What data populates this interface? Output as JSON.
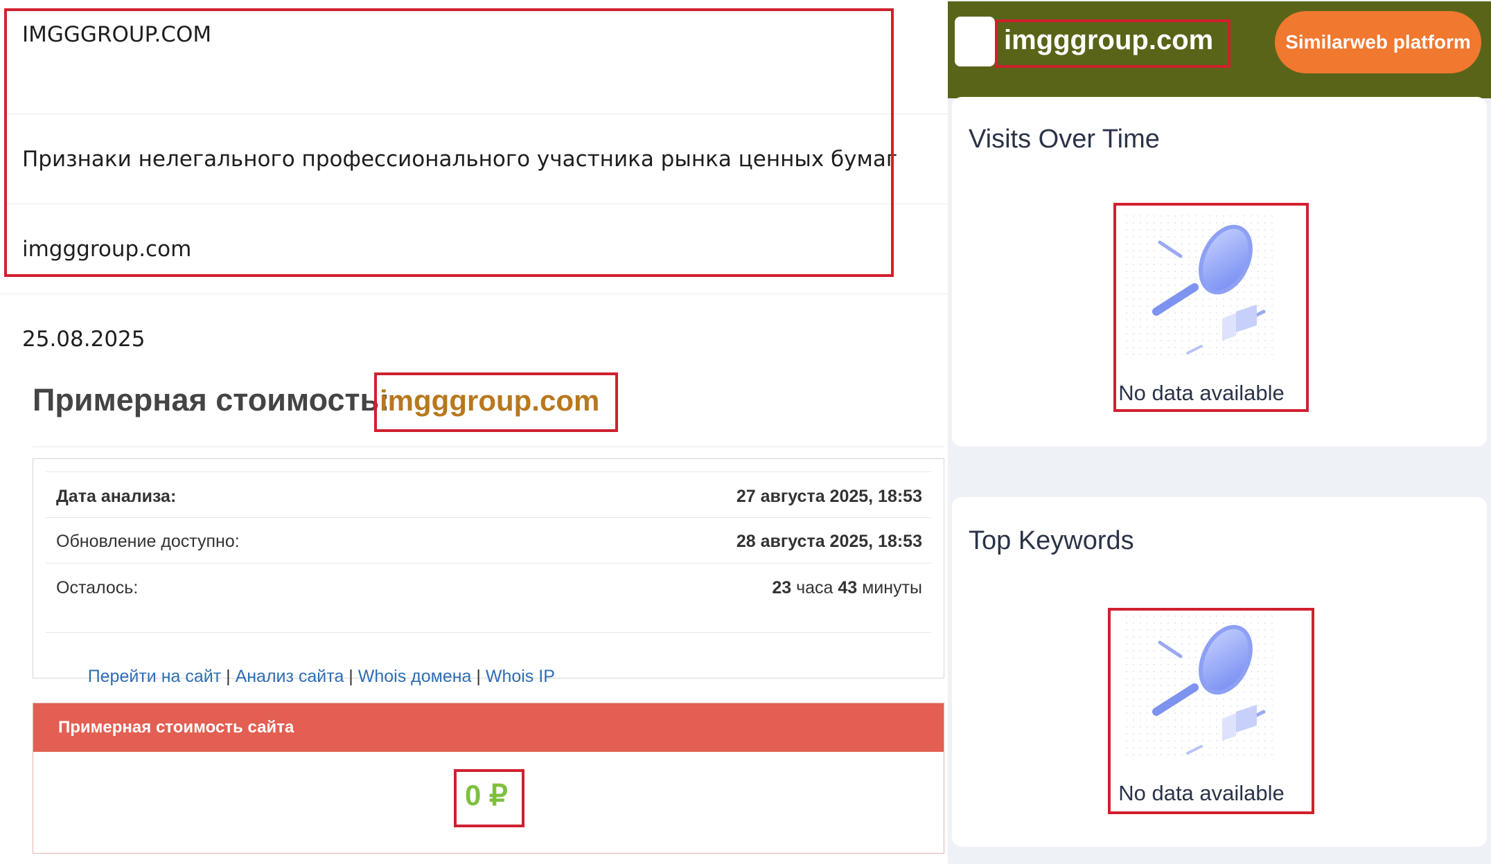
{
  "left": {
    "registry": {
      "name": "IMGGGROUP.COM",
      "sign": "Признаки нелегального профессионального участника рынка ценных бумаг",
      "domain": "imgggroup.com"
    },
    "date": "25.08.2025",
    "estimate": {
      "title": "Примерная стоимость:",
      "domain": "imgggroup.com"
    },
    "analysis": {
      "rows": [
        {
          "label": "Дата анализа:",
          "value": "27 августа 2025, 18:53"
        },
        {
          "label": "Обновление доступно:",
          "value": "28 августа 2025, 18:53"
        },
        {
          "label": "Осталось:",
          "value_num1": "23",
          "value_unit1": " часа ",
          "value_num2": "43",
          "value_unit2": " минуты"
        }
      ],
      "links": [
        "Перейти на сайт",
        "Анализ сайта",
        "Whois домена",
        "Whois IP"
      ],
      "separator": " | "
    },
    "cost": {
      "header": "Примерная стоимость сайта",
      "value": "0 ₽"
    }
  },
  "right": {
    "site": "imgggroup.com",
    "button": "Similarweb platform",
    "cards": [
      {
        "title": "Visits Over Time",
        "no_data": "No data available"
      },
      {
        "title": "Top Keywords",
        "no_data": "No data available"
      }
    ]
  },
  "colors": {
    "highlight_border": "#d0202f",
    "topbar": "#5a6418",
    "button": "#f0782f",
    "cost_header": "#e35f53",
    "cost_value": "#7dc03e",
    "domain_accent": "#b8781e",
    "link": "#2f6db5"
  }
}
